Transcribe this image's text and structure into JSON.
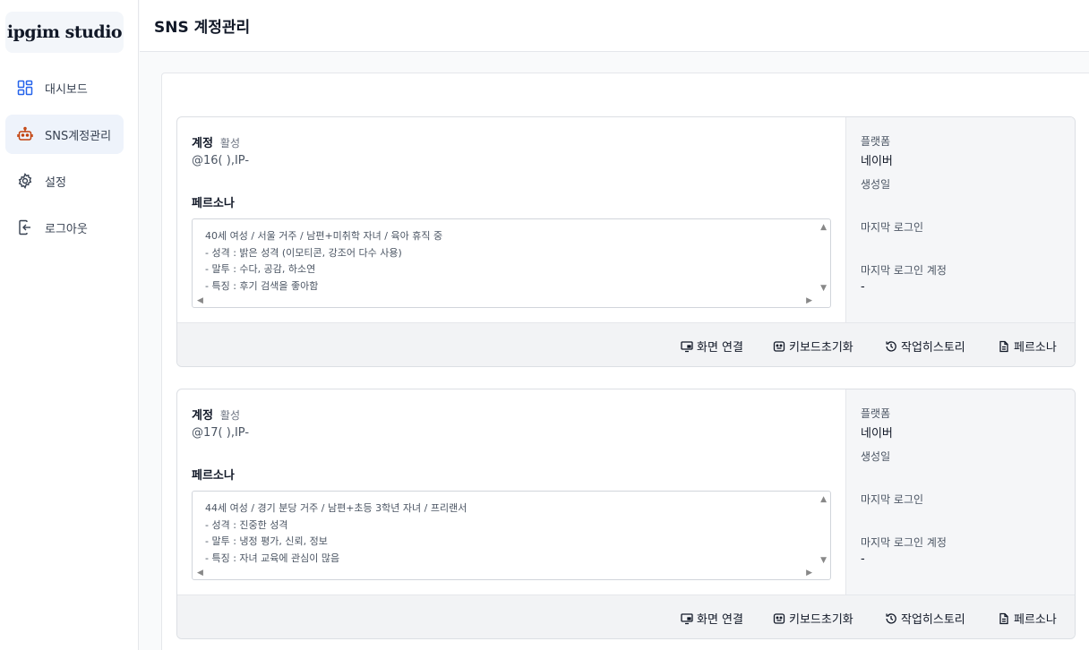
{
  "brand": {
    "logo_text": "ipgim studio"
  },
  "sidebar": {
    "items": [
      {
        "label": "대시보드",
        "icon": "dashboard-icon"
      },
      {
        "label": "SNS계정관리",
        "icon": "robot-icon",
        "active": true
      },
      {
        "label": "설정",
        "icon": "gear-icon"
      },
      {
        "label": "로그아웃",
        "icon": "logout-icon"
      }
    ]
  },
  "header": {
    "title": "SNS 계정관리"
  },
  "accent_color": "#c2410c",
  "accounts": [
    {
      "account_label": "계정",
      "status": "활성",
      "id": "@16(        ),IP-",
      "persona_label": "페르소나",
      "persona_text": "40세 여성 / 서울 거주 / 남편+미취학 자녀 / 육아 휴직 중\n- 성격 : 밝은 성격 (이모티콘, 강조어 다수 사용)\n- 말투 : 수다, 공감, 하소연\n- 특징 : 후기 검색을 좋아함",
      "platform_label": "플랫폼",
      "platform_value": "네이버",
      "created_label": "생성일",
      "last_login_label": "마지막 로그인",
      "last_login_account_label": "마지막 로그인 계정",
      "last_login_account_value": "-",
      "buttons": {
        "screen": "화면 연결",
        "keyboard": "키보드초기화",
        "history": "작업히스토리",
        "persona": "페르소나"
      }
    },
    {
      "account_label": "계정",
      "status": "활성",
      "id": "@17(        ),IP-",
      "persona_label": "페르소나",
      "persona_text": "44세 여성 / 경기 분당 거주 / 남편+초등 3학년 자녀 / 프리랜서\n- 성격 : 진중한 성격\n- 말투 : 냉정 평가, 신뢰, 정보\n- 특징 : 자녀 교육에 관심이 많음",
      "platform_label": "플랫폼",
      "platform_value": "네이버",
      "created_label": "생성일",
      "last_login_label": "마지막 로그인",
      "last_login_account_label": "마지막 로그인 계정",
      "last_login_account_value": "-",
      "buttons": {
        "screen": "화면 연결",
        "keyboard": "키보드초기화",
        "history": "작업히스토리",
        "persona": "페르소나"
      }
    }
  ]
}
